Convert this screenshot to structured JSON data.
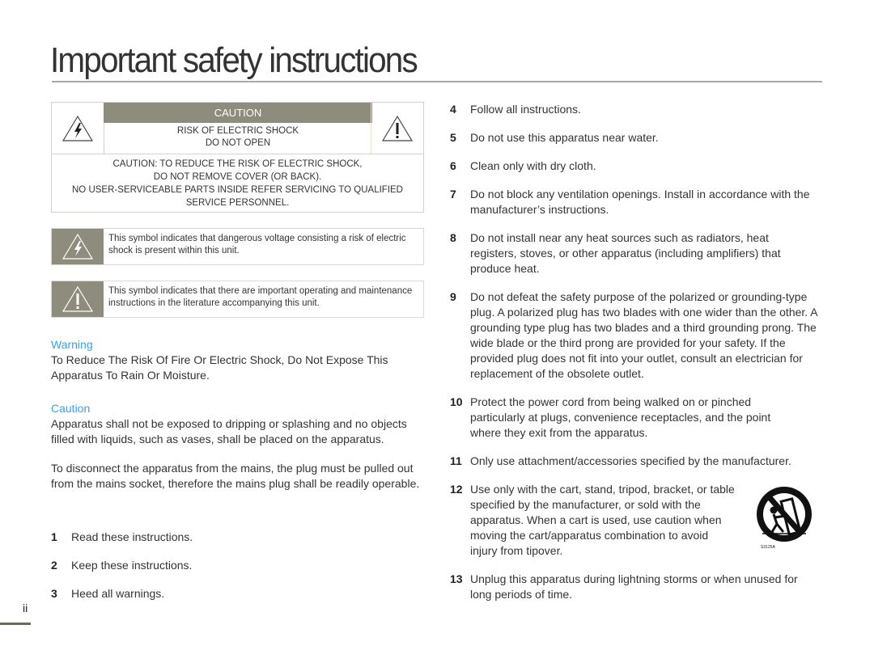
{
  "page": {
    "title": "Important safety instructions",
    "page_number": "ii"
  },
  "caution_label": {
    "header": "CAUTION",
    "sub_line1": "RISK OF ELECTRIC SHOCK",
    "sub_line2": "DO NOT OPEN",
    "body_line1": "CAUTION: TO REDUCE THE RISK OF ELECTRIC SHOCK,",
    "body_line2": "DO NOT REMOVE COVER (OR BACK).",
    "body_line3": "NO USER-SERVICEABLE PARTS INSIDE REFER SERVICING TO QUALIFIED",
    "body_line4": "SERVICE PERSONNEL.",
    "left_icon": "lightning-warning-icon",
    "right_icon": "exclamation-warning-icon"
  },
  "symbols": [
    {
      "icon": "lightning-warning-icon",
      "text": "This symbol indicates that dangerous voltage consisting a risk of electric shock is present within this unit."
    },
    {
      "icon": "exclamation-warning-icon",
      "text": "This symbol indicates that there are important operating and maintenance instructions in the literature accompanying this unit."
    }
  ],
  "warning": {
    "heading": "Warning",
    "text": "To Reduce The Risk Of Fire Or Electric Shock, Do Not Expose This Apparatus To Rain Or Moisture."
  },
  "caution": {
    "heading": "Caution",
    "text1": "Apparatus shall not be exposed to dripping or splashing and no objects filled with liquids, such as vases, shall be placed on the apparatus.",
    "text2": "To disconnect the apparatus from the mains, the plug must be pulled out from the mains socket, therefore the mains plug shall be readily operable."
  },
  "instructions": [
    {
      "num": "1",
      "text": "Read these instructions."
    },
    {
      "num": "2",
      "text": "Keep these instructions."
    },
    {
      "num": "3",
      "text": "Heed all warnings."
    },
    {
      "num": "4",
      "text": "Follow all instructions."
    },
    {
      "num": "5",
      "text": "Do not use this apparatus near water."
    },
    {
      "num": "6",
      "text": "Clean only with dry cloth."
    },
    {
      "num": "7",
      "text": "Do not block any ventilation openings. Install in accordance with the manufacturer’s instructions."
    },
    {
      "num": "8",
      "text": "Do not install near any heat sources such as radiators, heat registers, stoves, or other apparatus (including amplifiers) that produce heat."
    },
    {
      "num": "9",
      "text": "Do not defeat the safety purpose of the polarized or grounding-type plug. A polarized plug has two blades with one wider than the other. A grounding type plug has two blades and a third grounding prong. The wide blade or the third prong are provided for your safety. If the provided plug does not fit into your outlet, consult an electrician for replacement of the obsolete outlet."
    },
    {
      "num": "10",
      "text": "Protect the power cord from being walked on or pinched particularly at plugs, convenience receptacles, and the point where they exit from the apparatus."
    },
    {
      "num": "11",
      "text": "Only use attachment/accessories specified by the manufacturer."
    },
    {
      "num": "12",
      "text": "Use only with the cart, stand, tripod, bracket, or table specified by the manufacturer, or sold with the apparatus. When a cart is used, use caution when moving the cart/apparatus combination to avoid injury from tipover."
    },
    {
      "num": "13",
      "text": "Unplug this apparatus during lightning storms or when unused for long periods of time."
    }
  ],
  "cart_icon": {
    "icon": "cart-tipover-warning-icon",
    "label": "S3125A"
  },
  "colors": {
    "accent_heading": "#3aa0e8",
    "label_band": "#8e8c7c"
  }
}
